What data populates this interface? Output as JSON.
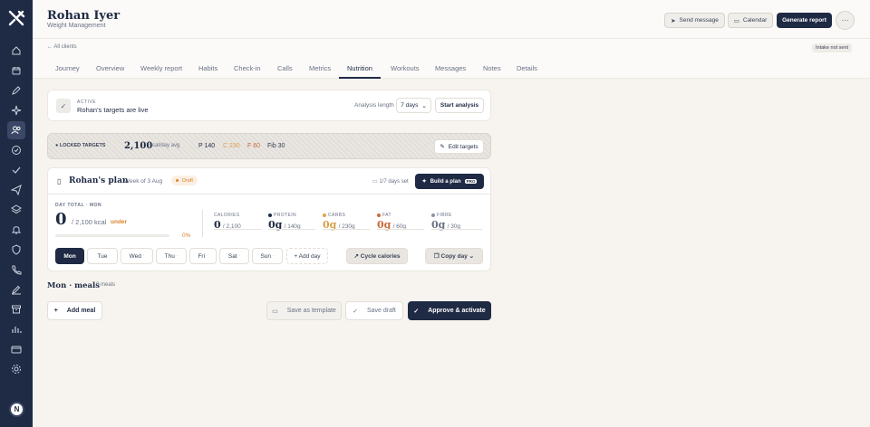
{
  "client": {
    "name": "Rohan Iyer",
    "program": "Weight Management"
  },
  "header_actions": {
    "send_message": "Send message",
    "calendar": "Calendar",
    "generate_report": "Generate report",
    "more": "···"
  },
  "breadcrumb": {
    "back": "All clients"
  },
  "intake_status": "Intake not sent",
  "tabs": [
    "Journey",
    "Overview",
    "Weekly report",
    "Habits",
    "Check-in",
    "Calls",
    "Metrics",
    "Nutrition",
    "Workouts",
    "Messages",
    "Notes",
    "Details"
  ],
  "active_tab": "Nutrition",
  "status_card": {
    "badge": "ACTIVE",
    "text": "Rohan's targets are live",
    "analysis_label": "Analysis length",
    "analysis_value": "7 days",
    "start_button": "Start analysis"
  },
  "locked_targets": {
    "label": "LOCKED TARGETS",
    "kcal": "2,100",
    "kcal_unit": "kcal/day avg",
    "protein": "P 140",
    "carbs": "C 230",
    "fat": "F 60",
    "fibre": "Fib 30",
    "edit_button": "Edit targets"
  },
  "plan": {
    "title": "Rohan's plan",
    "week": "· Week of 3 Aug",
    "status": "Draft",
    "days_set": "1/7 days set",
    "build_button": "Build a plan",
    "pro_badge": "PRO"
  },
  "day_total": {
    "label": "DAY TOTAL · MON",
    "value": "0",
    "of": "/ 2,100 kcal",
    "status": "under",
    "percent": "0%",
    "progress": 0
  },
  "macros": [
    {
      "label": "CALORIES",
      "value": "0",
      "of": "/ 2,100",
      "color": ""
    },
    {
      "label": "PROTEIN",
      "value": "0g",
      "of": "/ 140g",
      "color": "#1f2a44"
    },
    {
      "label": "CARBS",
      "value": "0g",
      "of": "/ 230g",
      "color": "#e0a449"
    },
    {
      "label": "FAT",
      "value": "0g",
      "of": "/ 60g",
      "color": "#cf6a3a"
    },
    {
      "label": "FIBRE",
      "value": "0g",
      "of": "/ 30g",
      "color": "#8a93a6"
    }
  ],
  "days": [
    "Mon",
    "Tue",
    "Wed",
    "Thu",
    "Fri",
    "Sat",
    "Sun"
  ],
  "add_day": "+ Add day",
  "cycle_calories": "Cycle calories",
  "copy_day": "Copy day",
  "meals": {
    "title": "Mon · meals",
    "count": "0 meals",
    "add_meal": "Add meal"
  },
  "footer_actions": {
    "save_template": "Save as template",
    "save_draft": "Save draft",
    "approve": "Approve & activate"
  },
  "user_initial": "N",
  "colors": {
    "navy": "#1f2a44",
    "orange": "#d9822b",
    "page_bg": "#f7f4ef"
  }
}
